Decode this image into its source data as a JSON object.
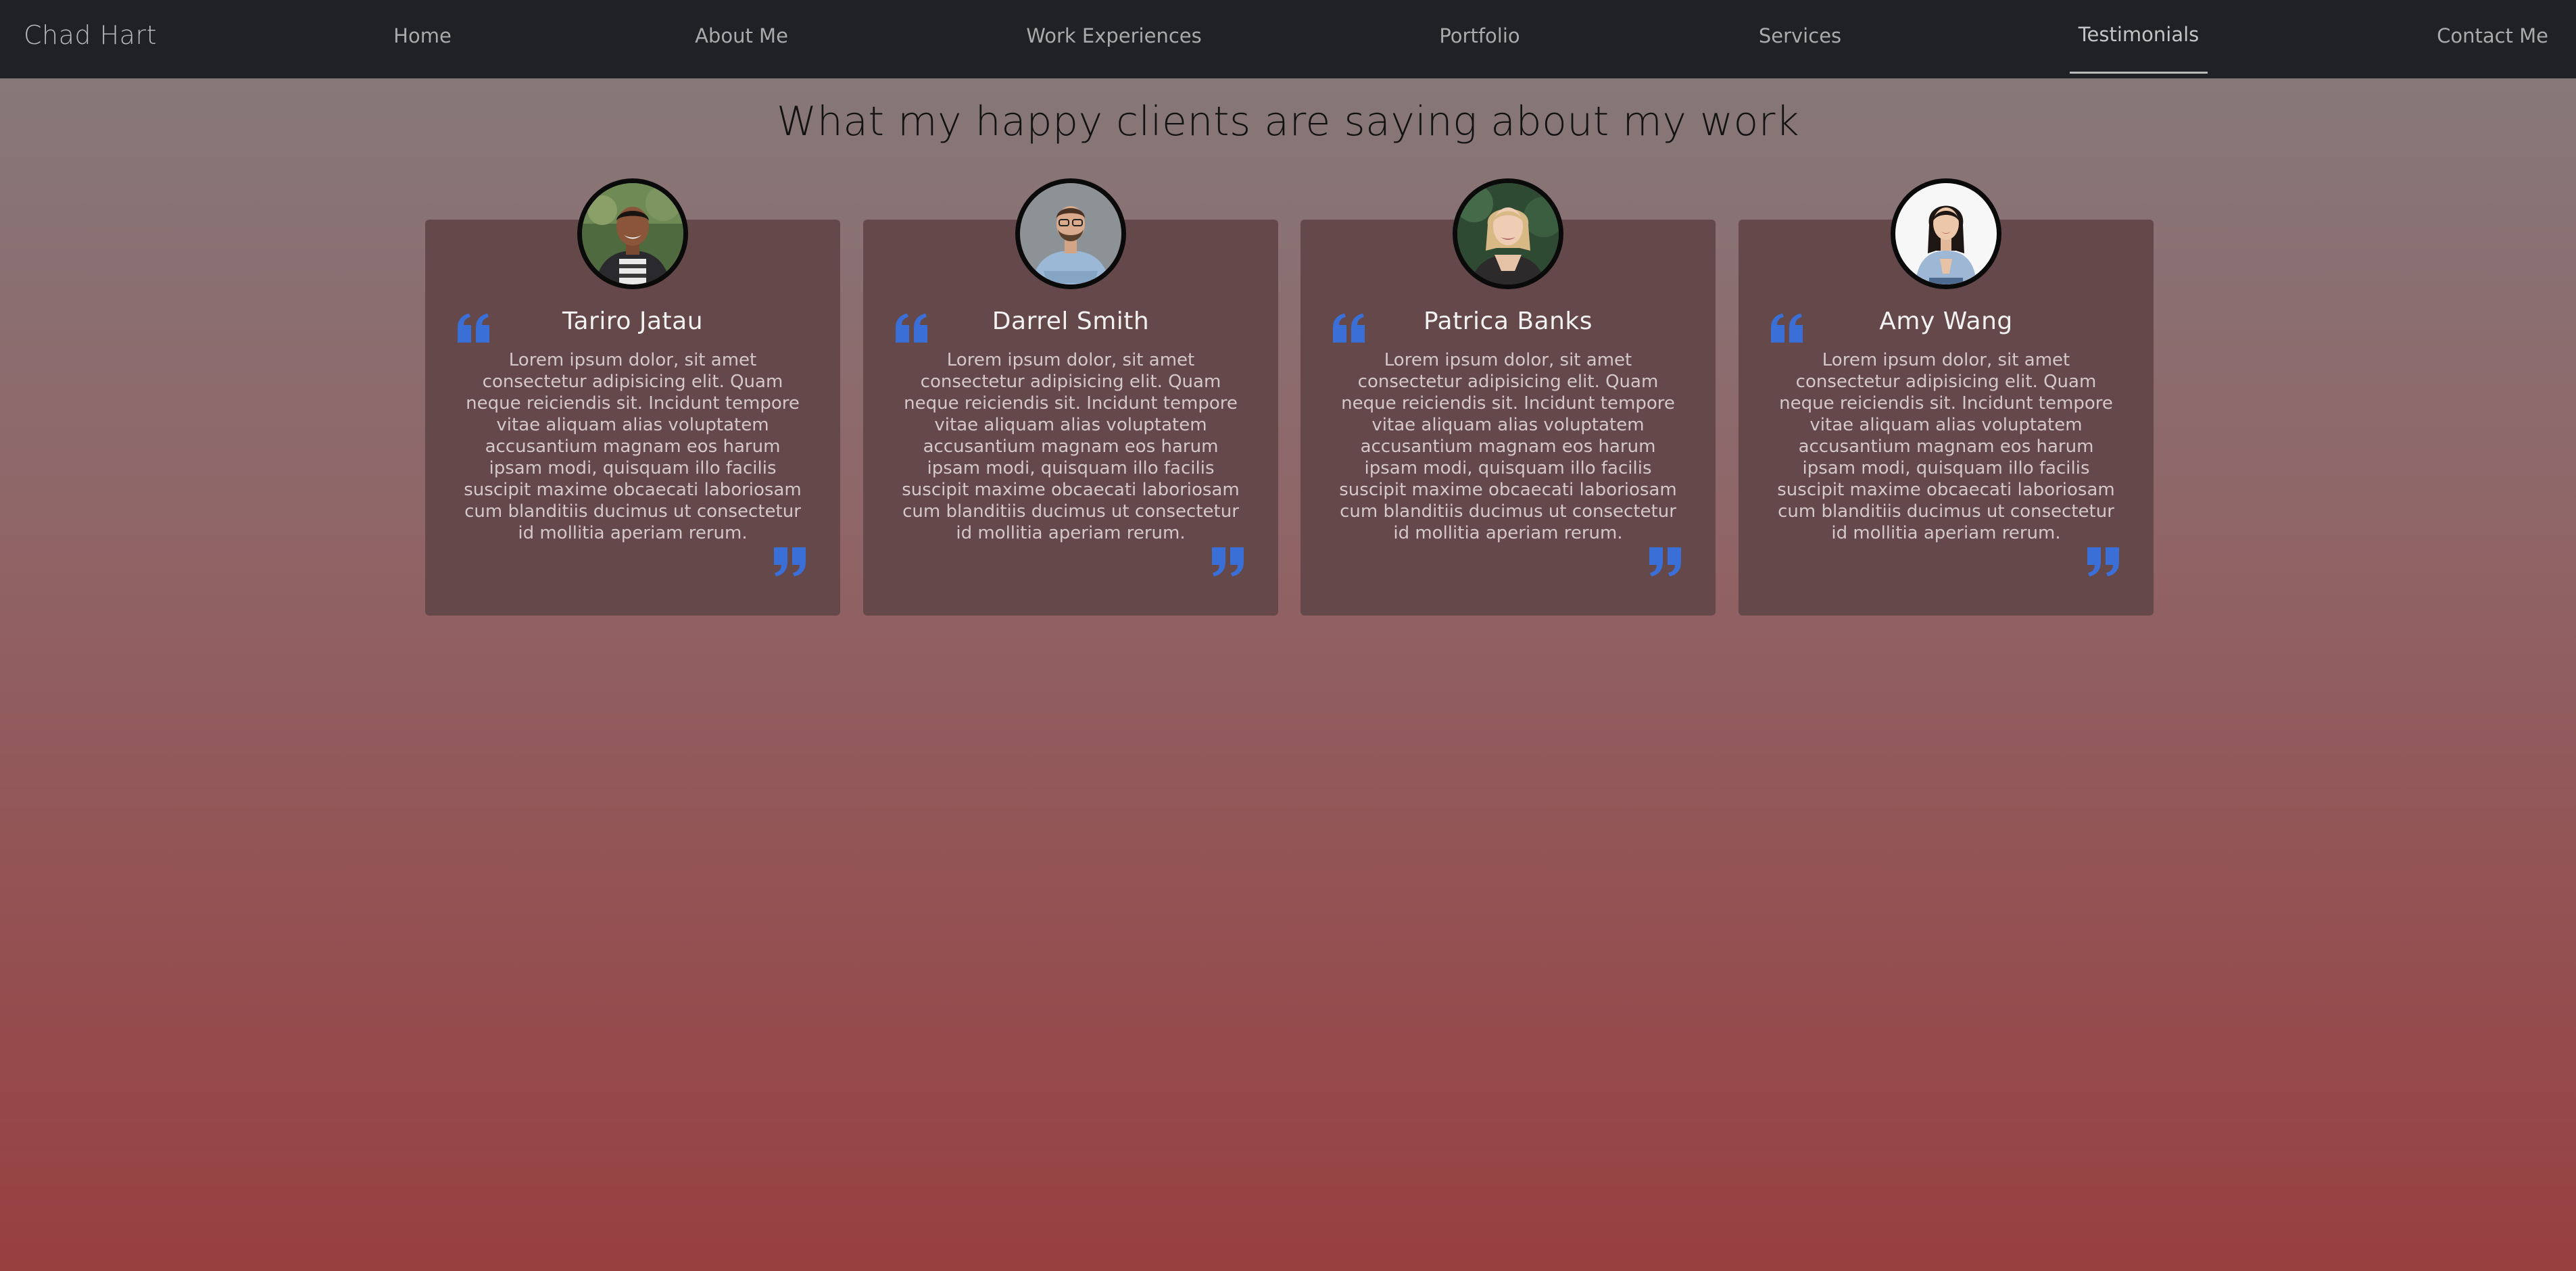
{
  "navbar": {
    "brand": "Chad Hart",
    "links": [
      {
        "label": "Home"
      },
      {
        "label": "About Me"
      },
      {
        "label": "Work Experiences"
      },
      {
        "label": "Portfolio"
      },
      {
        "label": "Services"
      },
      {
        "label": "Testimonials",
        "active": true
      },
      {
        "label": "Contact Me"
      }
    ]
  },
  "section": {
    "title": "What my happy clients are saying about my work"
  },
  "testimonials": [
    {
      "name": "Tariro Jatau",
      "text": "Lorem ipsum dolor, sit amet consectetur adipisicing elit. Quam neque reiciendis sit. Incidunt tempore vitae aliquam alias voluptatem accusantium magnam eos harum ipsam modi, quisquam illo facilis suscipit maxime obcaecati laboriosam cum blanditiis ducimus ut consectetur id mollitia aperiam rerum.",
      "avatar": "smiling-man-photo"
    },
    {
      "name": "Darrel Smith",
      "text": "Lorem ipsum dolor, sit amet consectetur adipisicing elit. Quam neque reiciendis sit. Incidunt tempore vitae aliquam alias voluptatem accusantium magnam eos harum ipsam modi, quisquam illo facilis suscipit maxime obcaecati laboriosam cum blanditiis ducimus ut consectetur id mollitia aperiam rerum.",
      "avatar": "man-with-glasses-photo"
    },
    {
      "name": "Patrica Banks",
      "text": "Lorem ipsum dolor, sit amet consectetur adipisicing elit. Quam neque reiciendis sit. Incidunt tempore vitae aliquam alias voluptatem accusantium magnam eos harum ipsam modi, quisquam illo facilis suscipit maxime obcaecati laboriosam cum blanditiis ducimus ut consectetur id mollitia aperiam rerum.",
      "avatar": "blonde-woman-photo"
    },
    {
      "name": "Amy Wang",
      "text": "Lorem ipsum dolor, sit amet consectetur adipisicing elit. Quam neque reiciendis sit. Incidunt tempore vitae aliquam alias voluptatem accusantium magnam eos harum ipsam modi, quisquam illo facilis suscipit maxime obcaecati laboriosam cum blanditiis ducimus ut consectetur id mollitia aperiam rerum.",
      "avatar": "woman-hands-together-photo"
    }
  ],
  "colors": {
    "navbar_bg": "#202124",
    "card_bg": "#654849",
    "quote_icon": "#3a6fd8",
    "gradient_top": "#857b7c",
    "gradient_bottom": "#983f40"
  }
}
